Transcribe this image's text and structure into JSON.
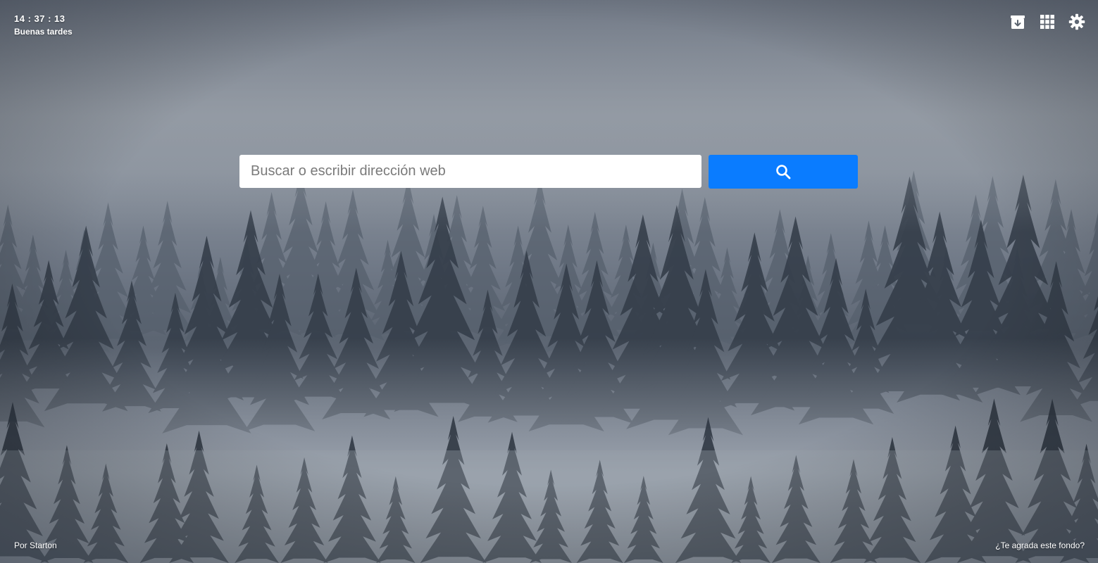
{
  "clock": {
    "time": "14 : 37 : 13",
    "greeting": "Buenas tardes"
  },
  "toolbar": {
    "icons": [
      "archive-download-icon",
      "apps-grid-icon",
      "gear-icon"
    ]
  },
  "search": {
    "placeholder": "Buscar o escribir dirección web",
    "value": "",
    "button_icon": "search-icon",
    "button_color": "#0a7cff"
  },
  "footer": {
    "credit": "Por Starton",
    "feedback": "¿Te agrada este fondo?"
  },
  "colors": {
    "fog": "#8a929d",
    "forest": "#2a323c",
    "text": "#ffffff"
  }
}
